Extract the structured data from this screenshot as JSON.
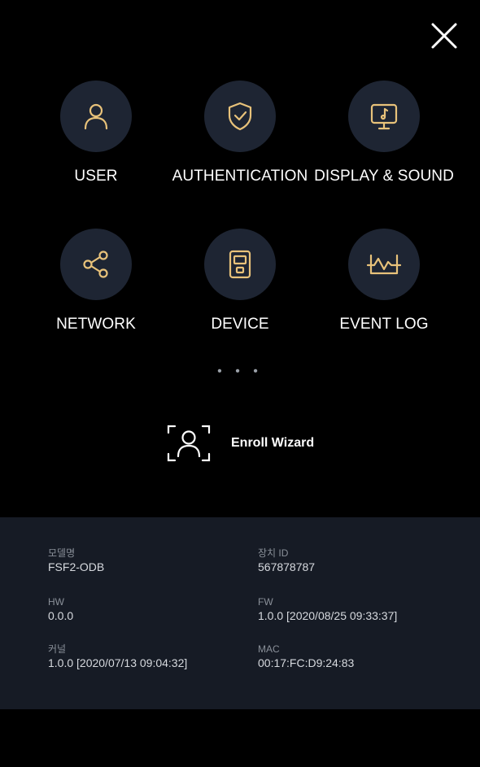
{
  "header": {
    "close_icon": "close-icon"
  },
  "accent_color": "#e8c27a",
  "menu": [
    {
      "label": "USER",
      "icon": "user-icon"
    },
    {
      "label": "AUTHENTICATION",
      "icon": "shield-check-icon"
    },
    {
      "label": "DISPLAY & SOUND",
      "icon": "display-sound-icon"
    },
    {
      "label": "NETWORK",
      "icon": "share-icon"
    },
    {
      "label": "DEVICE",
      "icon": "device-icon"
    },
    {
      "label": "EVENT LOG",
      "icon": "event-log-icon"
    }
  ],
  "more_indicator": "• • •",
  "enroll": {
    "label": "Enroll Wizard",
    "icon": "face-scan-icon"
  },
  "device_info": {
    "model_label": "모델명",
    "model_value": "FSF2-ODB",
    "device_id_label": "장치 ID",
    "device_id_value": "567878787",
    "hw_label": "HW",
    "hw_value": "0.0.0",
    "fw_label": "FW",
    "fw_value": "1.0.0 [2020/08/25 09:33:37]",
    "kernel_label": "커널",
    "kernel_value": "1.0.0 [2020/07/13 09:04:32]",
    "mac_label": "MAC",
    "mac_value": "00:17:FC:D9:24:83"
  }
}
